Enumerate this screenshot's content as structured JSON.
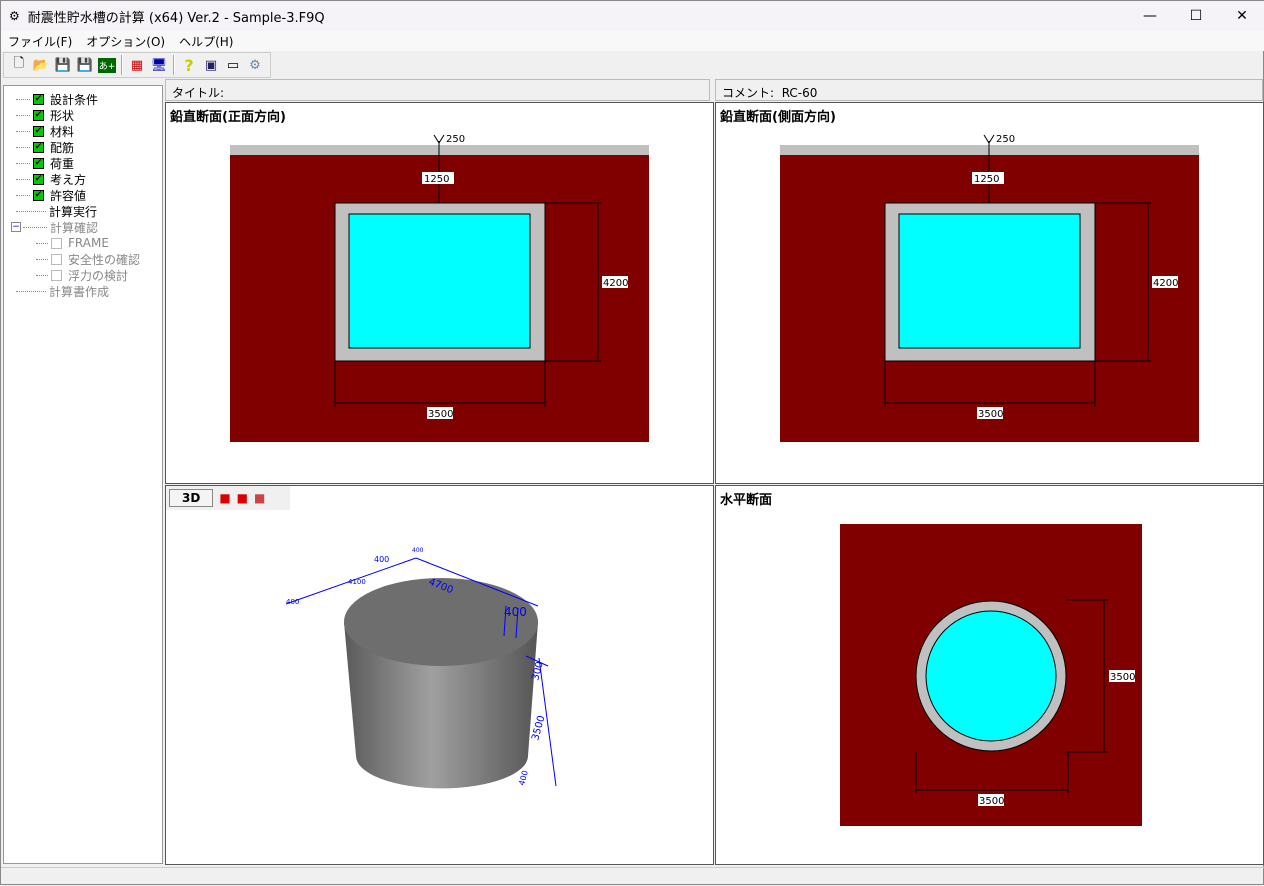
{
  "window": {
    "title": "耐震性貯水槽の計算 (x64) Ver.2 - Sample-3.F9Q",
    "minimize": "—",
    "maximize": "☐",
    "close": "✕"
  },
  "menu": [
    "ファイル(F)",
    "オプション(O)",
    "ヘルプ(H)"
  ],
  "toolbar": {
    "icons": [
      "new-file-icon",
      "open-folder-icon",
      "save-icon",
      "save-as-icon",
      "export-icon",
      "check-edit-icon",
      "computer-icon",
      "help-icon",
      "book-icon",
      "card-icon",
      "app-icon"
    ]
  },
  "tree": {
    "checked": [
      "設計条件",
      "形状",
      "材料",
      "配筋",
      "荷重",
      "考え方",
      "許容値"
    ],
    "run": "計算実行",
    "confirm": "計算確認",
    "confirm_children": [
      "FRAME",
      "安全性の確認",
      "浮力の検討"
    ],
    "report": "計算書作成",
    "expander": "−"
  },
  "header": {
    "title_label": "タイトル:",
    "title_value": "",
    "comment_label": "コメント:",
    "comment_value": "RC-60"
  },
  "panels": {
    "front": {
      "title": "鉛直断面(正面方向)",
      "dims": {
        "top": "250",
        "cover": "1250",
        "height": "4200",
        "width": "3500"
      }
    },
    "side": {
      "title": "鉛直断面(側面方向)",
      "dims": {
        "top": "250",
        "cover": "1250",
        "height": "4200",
        "width": "3500"
      }
    },
    "view3d": {
      "button": "3D",
      "dims": [
        "400",
        "4100",
        "400",
        "400",
        "4700",
        "400",
        "300",
        "3500",
        "400"
      ]
    },
    "plan": {
      "title": "水平断面",
      "dims": {
        "height": "3500",
        "width": "3500"
      }
    }
  },
  "colors": {
    "soil": "#800000",
    "concrete": "#c0c0c0",
    "water": "#00ffff",
    "dim3d": "#0000ff"
  }
}
